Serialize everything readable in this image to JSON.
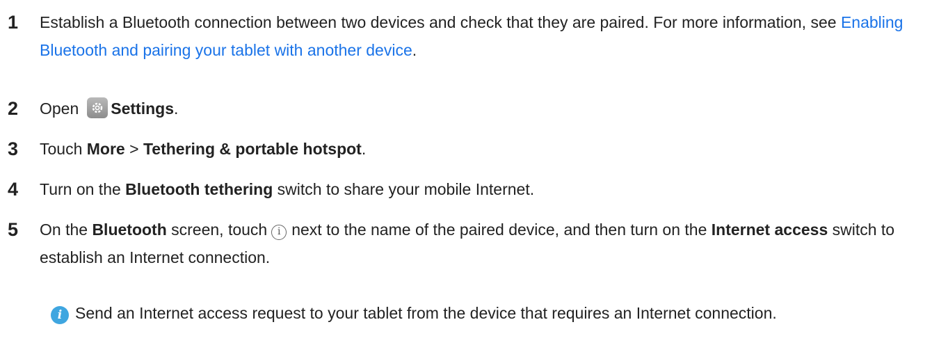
{
  "steps": [
    {
      "number": "1",
      "text_a": "Establish a Bluetooth connection between two devices and check that they are paired. For more information, see ",
      "link": "Enabling Bluetooth and pairing your tablet with another device",
      "text_b": "."
    },
    {
      "number": "2",
      "text_a": "Open",
      "icon": "settings-gear-icon",
      "bold": "Settings",
      "text_b": "."
    },
    {
      "number": "3",
      "text_a": "Touch ",
      "bold_1": "More",
      "sep": " > ",
      "bold_2": "Tethering & portable hotspot",
      "text_b": "."
    },
    {
      "number": "4",
      "text_a": "Turn on the ",
      "bold": "Bluetooth tethering",
      "text_b": " switch to share your mobile Internet."
    },
    {
      "number": "5",
      "text_a": "On the ",
      "bold_1": "Bluetooth",
      "text_b": " screen, touch",
      "icon": "info-circle-icon",
      "icon_glyph": "i",
      "text_c": "next to the name of the paired device, and then turn on the ",
      "bold_2": "Internet access",
      "text_d": " switch to establish an Internet connection."
    }
  ],
  "note": {
    "icon": "info-note-icon",
    "icon_glyph": "i",
    "text": "Send an Internet access request to your tablet from the device that requires an Internet connection."
  },
  "colors": {
    "text": "#222222",
    "link": "#1a73e8",
    "note_icon": "#3fa6e0"
  }
}
